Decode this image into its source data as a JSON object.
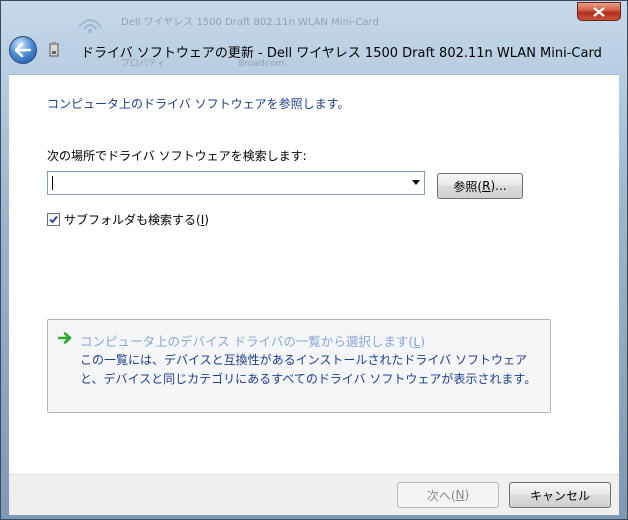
{
  "window": {
    "title": "ドライバ ソフトウェアの更新 - Dell ワイヤレス 1500 Draft 802.11n WLAN Mini-Card",
    "background_ghost_text": "Dell ワイヤレス 1500 Draft 802.11n WLAN Mini-Card",
    "background_ghost_labels": [
      "プロパティ",
      "Broadcom"
    ]
  },
  "content": {
    "heading": "コンピュータ上のドライバ ソフトウェアを参照します。",
    "search_label": "次の場所でドライバ ソフトウェアを検索します:",
    "location_value": "",
    "browse_button_pre": "参照(",
    "browse_button_key": "R",
    "browse_button_post": ")...",
    "include_subfolders_pre": "サブフォルダも検索する(",
    "include_subfolders_key": "I",
    "include_subfolders_post": ")",
    "include_subfolders_checked": true,
    "pick_list_link_pre": "コンピュータ上のデバイス ドライバの一覧から選択します(",
    "pick_list_link_key": "L",
    "pick_list_link_post": ")",
    "pick_list_description": "この一覧には、デバイスと互換性があるインストールされたドライバ ソフトウェアと、デバイスと同じカテゴリにあるすべてのドライバ ソフトウェアが表示されます。"
  },
  "footer": {
    "next_pre": "次へ(",
    "next_key": "N",
    "next_post": ")",
    "next_enabled": false,
    "cancel_label": "キャンセル"
  },
  "icons": [
    "back-arrow-icon",
    "device-icon",
    "close-icon",
    "green-arrow-icon",
    "dropdown-arrow-icon",
    "checkmark-icon",
    "wireless-network-icon"
  ],
  "colors": {
    "link_blue": "#1e3d8a",
    "disabled_link": "#8aa7d6",
    "close_red": "#c9523a",
    "arrow_green": "#2fa82f"
  }
}
